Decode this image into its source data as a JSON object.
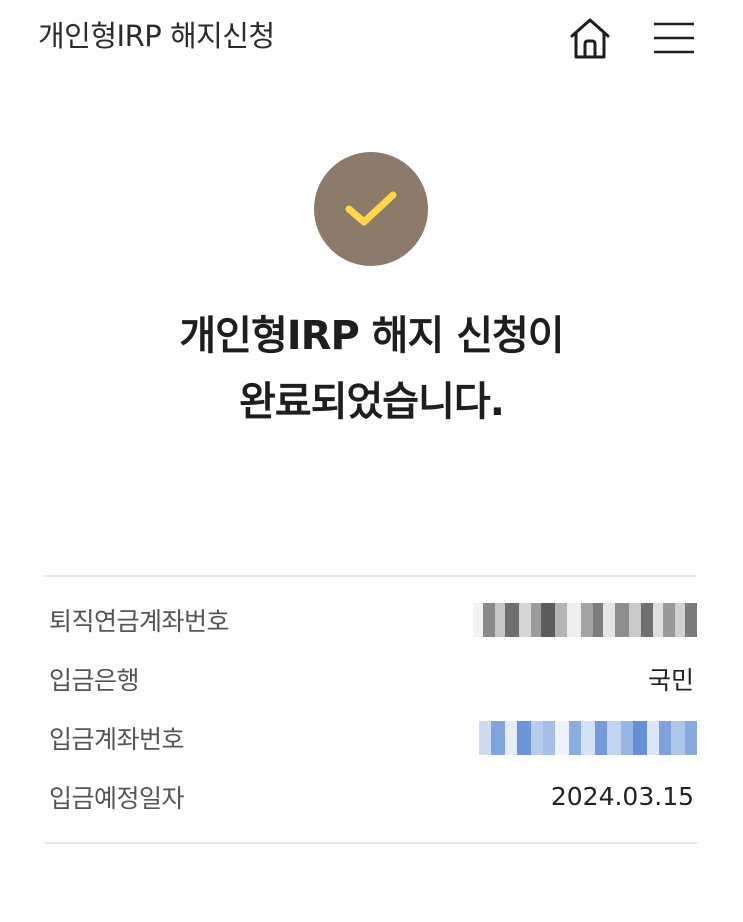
{
  "header": {
    "title": "개인형IRP 해지신청",
    "home_icon": "home-icon",
    "menu_icon": "hamburger-menu-icon"
  },
  "result": {
    "icon": "check-icon",
    "icon_color": "#ffd84a",
    "circle_color": "#8c7a6b",
    "title_line1": "개인형IRP 해지 신청이",
    "title_line2": "완료되었습니다."
  },
  "details": [
    {
      "label": "퇴직연금계좌번호",
      "value": "",
      "masked": true,
      "mask_color": "gray"
    },
    {
      "label": "입금은행",
      "value": "국민",
      "masked": false
    },
    {
      "label": "입금계좌번호",
      "value": "",
      "masked": true,
      "mask_color": "blue"
    },
    {
      "label": "입금예정일자",
      "value": "2024.03.15",
      "masked": false
    }
  ]
}
